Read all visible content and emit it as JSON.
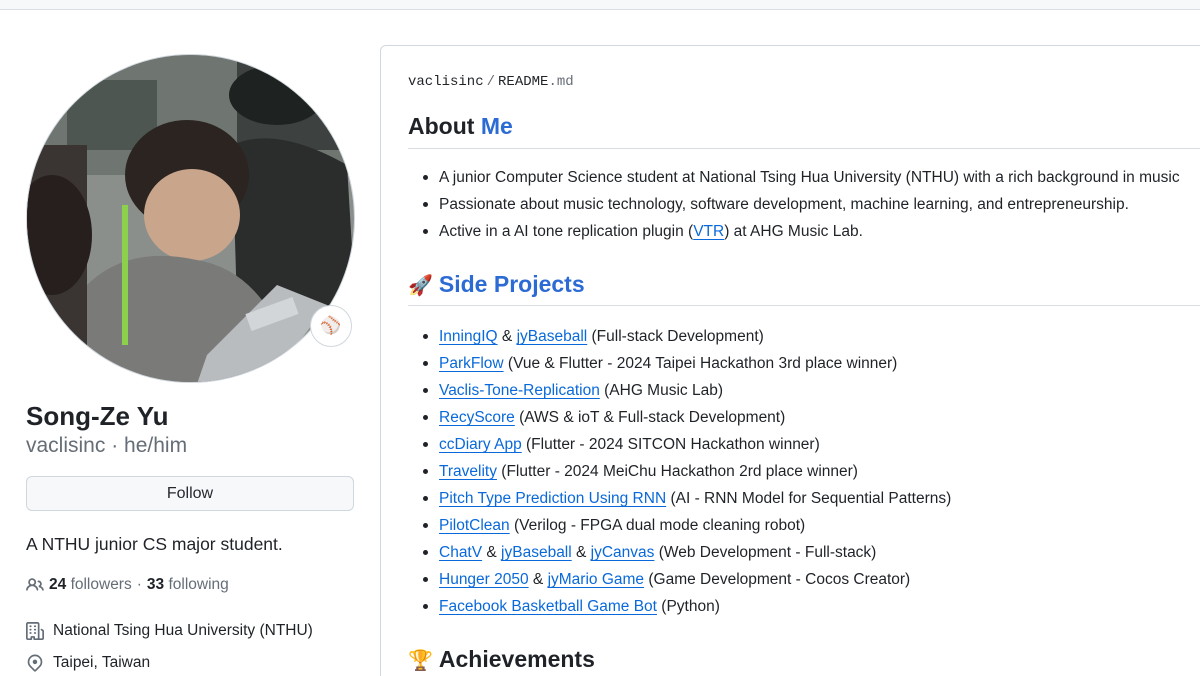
{
  "profile": {
    "name": "Song-Ze Yu",
    "login": "vaclisinc",
    "separator": "·",
    "pronouns": "he/him",
    "follow_label": "Follow",
    "status_emoji": "⚾",
    "bio": "A NTHU junior CS major student.",
    "followers_count": "24",
    "followers_label": "followers",
    "following_count": "33",
    "following_label": "following",
    "organization": "National Tsing Hua University (NTHU)",
    "location": "Taipei, Taiwan"
  },
  "readme": {
    "owner": "vaclisinc",
    "path_sep": "/",
    "file_base": "README",
    "file_ext": ".md",
    "about": {
      "title_plain": "About",
      "title_accent": "Me",
      "items": [
        {
          "text": "A junior Computer Science student at National Tsing Hua University (NTHU) with a rich background in music"
        },
        {
          "text": "Passionate about music technology, software development, machine learning, and entrepreneurship."
        },
        {
          "before": "Active in a AI tone replication plugin (",
          "link": "VTR",
          "after": ") at AHG Music Lab."
        }
      ]
    },
    "projects": {
      "emoji": "🚀",
      "title": "Side Projects",
      "items": [
        {
          "links": [
            "InningIQ",
            "jyBaseball"
          ],
          "joiner": " & ",
          "desc": " (Full-stack Development)"
        },
        {
          "links": [
            "ParkFlow"
          ],
          "joiner": "",
          "desc": " (Vue & Flutter - 2024 Taipei Hackathon 3rd place winner)"
        },
        {
          "links": [
            "Vaclis-Tone-Replication"
          ],
          "joiner": "",
          "desc": " (AHG Music Lab)"
        },
        {
          "links": [
            "RecyScore"
          ],
          "joiner": "",
          "desc": " (AWS & ioT & Full-stack Development)"
        },
        {
          "links": [
            "ccDiary App"
          ],
          "joiner": "",
          "desc": " (Flutter - 2024 SITCON Hackathon winner)"
        },
        {
          "links": [
            "Travelity"
          ],
          "joiner": "",
          "desc": " (Flutter - 2024 MeiChu Hackathon 2rd place winner)"
        },
        {
          "links": [
            "Pitch Type Prediction Using RNN"
          ],
          "joiner": "",
          "desc": " (AI - RNN Model for Sequential Patterns)"
        },
        {
          "links": [
            "PilotClean"
          ],
          "joiner": "",
          "desc": " (Verilog - FPGA dual mode cleaning robot)"
        },
        {
          "links": [
            "ChatV",
            "jyBaseball",
            "jyCanvas"
          ],
          "joiner": " & ",
          "desc": " (Web Development - Full-stack)"
        },
        {
          "links": [
            "Hunger 2050",
            "jyMario Game"
          ],
          "joiner": " & ",
          "desc": " (Game Development - Cocos Creator)"
        },
        {
          "links": [
            "Facebook Basketball Game Bot"
          ],
          "joiner": "",
          "desc": " (Python)"
        }
      ]
    },
    "achievements": {
      "emoji": "🏆",
      "title": "Achievements"
    }
  },
  "icons": {
    "followers": "people-icon",
    "organization": "building-icon",
    "location": "location-pin-icon",
    "status": "baseball-emoji"
  },
  "colors": {
    "link": "#0969da",
    "heading_accent": "#2c6bd4",
    "muted": "#656d76",
    "border": "#d0d7de"
  }
}
